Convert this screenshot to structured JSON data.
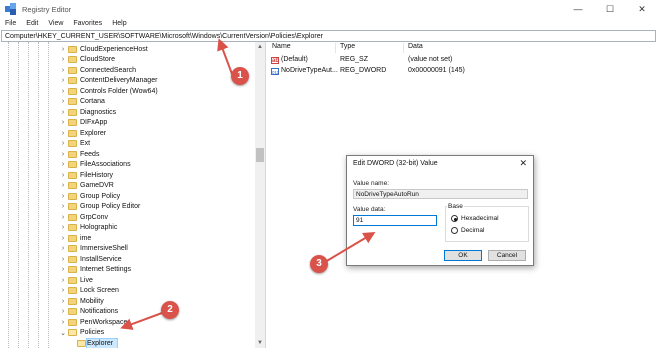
{
  "window": {
    "title": "Registry Editor",
    "minimize_glyph": "—",
    "maximize_glyph": "☐",
    "close_glyph": "✕"
  },
  "menu": [
    "File",
    "Edit",
    "View",
    "Favorites",
    "Help"
  ],
  "address": "Computer\\HKEY_CURRENT_USER\\SOFTWARE\\Microsoft\\Windows\\CurrentVersion\\Policies\\Explorer",
  "tree": {
    "items": [
      {
        "label": "CloudExperienceHost",
        "chev": "›"
      },
      {
        "label": "CloudStore",
        "chev": "›"
      },
      {
        "label": "ConnectedSearch",
        "chev": "›"
      },
      {
        "label": "ContentDeliveryManager",
        "chev": "›"
      },
      {
        "label": "Controls Folder (Wow64)",
        "chev": "›"
      },
      {
        "label": "Cortana",
        "chev": "›"
      },
      {
        "label": "Diagnostics",
        "chev": "›"
      },
      {
        "label": "DIFxApp",
        "chev": "›"
      },
      {
        "label": "Explorer",
        "chev": "›"
      },
      {
        "label": "Ext",
        "chev": "›"
      },
      {
        "label": "Feeds",
        "chev": "›"
      },
      {
        "label": "FileAssociations",
        "chev": "›"
      },
      {
        "label": "FileHistory",
        "chev": "›"
      },
      {
        "label": "GameDVR",
        "chev": "›"
      },
      {
        "label": "Group Policy",
        "chev": "›"
      },
      {
        "label": "Group Policy Editor",
        "chev": "›"
      },
      {
        "label": "GrpConv",
        "chev": "›"
      },
      {
        "label": "Holographic",
        "chev": "›"
      },
      {
        "label": "ime",
        "chev": "›"
      },
      {
        "label": "ImmersiveShell",
        "chev": "›"
      },
      {
        "label": "InstallService",
        "chev": "›"
      },
      {
        "label": "Internet Settings",
        "chev": "›"
      },
      {
        "label": "Live",
        "chev": "›"
      },
      {
        "label": "Lock Screen",
        "chev": "›"
      },
      {
        "label": "Mobility",
        "chev": "›"
      },
      {
        "label": "Notifications",
        "chev": "›"
      },
      {
        "label": "PenWorkspace",
        "chev": "›"
      },
      {
        "label": "Policies",
        "chev": "⌄"
      },
      {
        "label": "Explorer",
        "chev": ""
      },
      {
        "label": "PrecisionTouchPad",
        "chev": "›"
      }
    ]
  },
  "values_pane": {
    "columns": [
      "Name",
      "Type",
      "Data"
    ],
    "rows": [
      {
        "icon": "string-value-icon",
        "icon_glyph": "ab",
        "name": "(Default)",
        "type": "REG_SZ",
        "data": "(value not set)"
      },
      {
        "icon": "dword-value-icon",
        "icon_glyph": "011",
        "name": "NoDriveTypeAut...",
        "type": "REG_DWORD",
        "data": "0x00000091 (145)"
      }
    ]
  },
  "dialog": {
    "title": "Edit DWORD (32-bit) Value",
    "close_glyph": "✕",
    "value_name_label": "Value name:",
    "value_name": "NoDriveTypeAutoRun",
    "value_data_label": "Value data:",
    "value_data": "91",
    "base_label": "Base",
    "hex_label": "Hexadecimal",
    "dec_label": "Decimal",
    "selected_base": "Hexadecimal",
    "ok_label": "OK",
    "cancel_label": "Cancel"
  },
  "annotations": [
    {
      "number": "1"
    },
    {
      "number": "2"
    },
    {
      "number": "3"
    }
  ],
  "colors": {
    "annotation": "#d9534a",
    "selection": "#cce8ff",
    "focus": "#0078d7"
  }
}
